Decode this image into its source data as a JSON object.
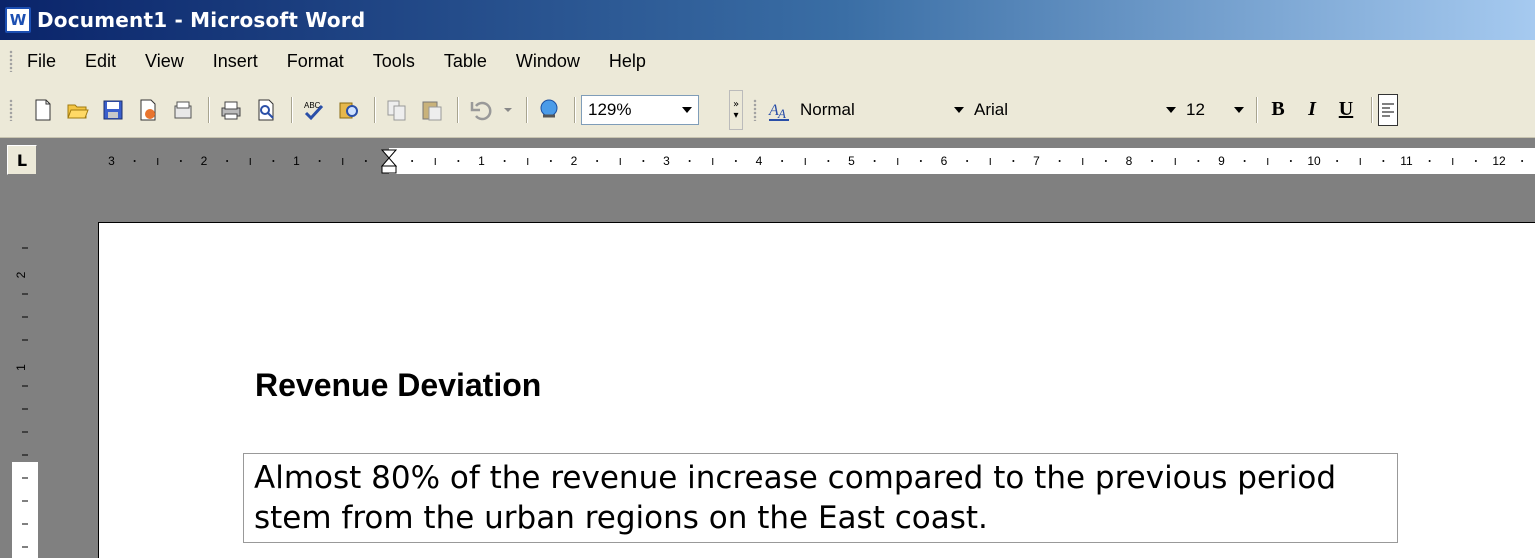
{
  "window": {
    "title": "Document1 - Microsoft Word",
    "app_icon": "word-icon"
  },
  "menubar": {
    "items": [
      "File",
      "Edit",
      "View",
      "Insert",
      "Format",
      "Tools",
      "Table",
      "Window",
      "Help"
    ]
  },
  "toolbar": {
    "zoom": "129%",
    "style": "Normal",
    "font": "Arial",
    "size": "12",
    "bold_label": "B",
    "italic_label": "I",
    "underline_label": "U"
  },
  "ruler": {
    "left_labels": [
      "3",
      "2",
      "1"
    ],
    "right_labels": [
      "1",
      "2",
      "3",
      "4",
      "5",
      "6",
      "7",
      "8",
      "9",
      "10",
      "11",
      "12"
    ],
    "tab_selector": "L"
  },
  "vruler": {
    "labels": [
      "2",
      "1"
    ]
  },
  "document": {
    "heading": "Revenue Deviation",
    "textbox_line1": "Almost 80% of the revenue increase compared to the previous period",
    "textbox_line2": "stem from the urban regions on the East coast."
  }
}
